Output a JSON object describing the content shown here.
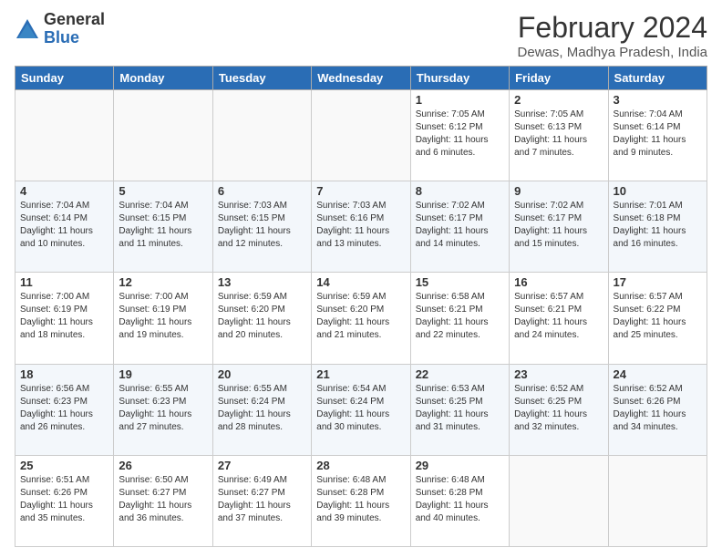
{
  "header": {
    "logo_general": "General",
    "logo_blue": "Blue",
    "month_title": "February 2024",
    "location": "Dewas, Madhya Pradesh, India"
  },
  "weekdays": [
    "Sunday",
    "Monday",
    "Tuesday",
    "Wednesday",
    "Thursday",
    "Friday",
    "Saturday"
  ],
  "weeks": [
    [
      {
        "day": "",
        "sunrise": "",
        "sunset": "",
        "daylight": ""
      },
      {
        "day": "",
        "sunrise": "",
        "sunset": "",
        "daylight": ""
      },
      {
        "day": "",
        "sunrise": "",
        "sunset": "",
        "daylight": ""
      },
      {
        "day": "",
        "sunrise": "",
        "sunset": "",
        "daylight": ""
      },
      {
        "day": "1",
        "sunrise": "Sunrise: 7:05 AM",
        "sunset": "Sunset: 6:12 PM",
        "daylight": "Daylight: 11 hours and 6 minutes."
      },
      {
        "day": "2",
        "sunrise": "Sunrise: 7:05 AM",
        "sunset": "Sunset: 6:13 PM",
        "daylight": "Daylight: 11 hours and 7 minutes."
      },
      {
        "day": "3",
        "sunrise": "Sunrise: 7:04 AM",
        "sunset": "Sunset: 6:14 PM",
        "daylight": "Daylight: 11 hours and 9 minutes."
      }
    ],
    [
      {
        "day": "4",
        "sunrise": "Sunrise: 7:04 AM",
        "sunset": "Sunset: 6:14 PM",
        "daylight": "Daylight: 11 hours and 10 minutes."
      },
      {
        "day": "5",
        "sunrise": "Sunrise: 7:04 AM",
        "sunset": "Sunset: 6:15 PM",
        "daylight": "Daylight: 11 hours and 11 minutes."
      },
      {
        "day": "6",
        "sunrise": "Sunrise: 7:03 AM",
        "sunset": "Sunset: 6:15 PM",
        "daylight": "Daylight: 11 hours and 12 minutes."
      },
      {
        "day": "7",
        "sunrise": "Sunrise: 7:03 AM",
        "sunset": "Sunset: 6:16 PM",
        "daylight": "Daylight: 11 hours and 13 minutes."
      },
      {
        "day": "8",
        "sunrise": "Sunrise: 7:02 AM",
        "sunset": "Sunset: 6:17 PM",
        "daylight": "Daylight: 11 hours and 14 minutes."
      },
      {
        "day": "9",
        "sunrise": "Sunrise: 7:02 AM",
        "sunset": "Sunset: 6:17 PM",
        "daylight": "Daylight: 11 hours and 15 minutes."
      },
      {
        "day": "10",
        "sunrise": "Sunrise: 7:01 AM",
        "sunset": "Sunset: 6:18 PM",
        "daylight": "Daylight: 11 hours and 16 minutes."
      }
    ],
    [
      {
        "day": "11",
        "sunrise": "Sunrise: 7:00 AM",
        "sunset": "Sunset: 6:19 PM",
        "daylight": "Daylight: 11 hours and 18 minutes."
      },
      {
        "day": "12",
        "sunrise": "Sunrise: 7:00 AM",
        "sunset": "Sunset: 6:19 PM",
        "daylight": "Daylight: 11 hours and 19 minutes."
      },
      {
        "day": "13",
        "sunrise": "Sunrise: 6:59 AM",
        "sunset": "Sunset: 6:20 PM",
        "daylight": "Daylight: 11 hours and 20 minutes."
      },
      {
        "day": "14",
        "sunrise": "Sunrise: 6:59 AM",
        "sunset": "Sunset: 6:20 PM",
        "daylight": "Daylight: 11 hours and 21 minutes."
      },
      {
        "day": "15",
        "sunrise": "Sunrise: 6:58 AM",
        "sunset": "Sunset: 6:21 PM",
        "daylight": "Daylight: 11 hours and 22 minutes."
      },
      {
        "day": "16",
        "sunrise": "Sunrise: 6:57 AM",
        "sunset": "Sunset: 6:21 PM",
        "daylight": "Daylight: 11 hours and 24 minutes."
      },
      {
        "day": "17",
        "sunrise": "Sunrise: 6:57 AM",
        "sunset": "Sunset: 6:22 PM",
        "daylight": "Daylight: 11 hours and 25 minutes."
      }
    ],
    [
      {
        "day": "18",
        "sunrise": "Sunrise: 6:56 AM",
        "sunset": "Sunset: 6:23 PM",
        "daylight": "Daylight: 11 hours and 26 minutes."
      },
      {
        "day": "19",
        "sunrise": "Sunrise: 6:55 AM",
        "sunset": "Sunset: 6:23 PM",
        "daylight": "Daylight: 11 hours and 27 minutes."
      },
      {
        "day": "20",
        "sunrise": "Sunrise: 6:55 AM",
        "sunset": "Sunset: 6:24 PM",
        "daylight": "Daylight: 11 hours and 28 minutes."
      },
      {
        "day": "21",
        "sunrise": "Sunrise: 6:54 AM",
        "sunset": "Sunset: 6:24 PM",
        "daylight": "Daylight: 11 hours and 30 minutes."
      },
      {
        "day": "22",
        "sunrise": "Sunrise: 6:53 AM",
        "sunset": "Sunset: 6:25 PM",
        "daylight": "Daylight: 11 hours and 31 minutes."
      },
      {
        "day": "23",
        "sunrise": "Sunrise: 6:52 AM",
        "sunset": "Sunset: 6:25 PM",
        "daylight": "Daylight: 11 hours and 32 minutes."
      },
      {
        "day": "24",
        "sunrise": "Sunrise: 6:52 AM",
        "sunset": "Sunset: 6:26 PM",
        "daylight": "Daylight: 11 hours and 34 minutes."
      }
    ],
    [
      {
        "day": "25",
        "sunrise": "Sunrise: 6:51 AM",
        "sunset": "Sunset: 6:26 PM",
        "daylight": "Daylight: 11 hours and 35 minutes."
      },
      {
        "day": "26",
        "sunrise": "Sunrise: 6:50 AM",
        "sunset": "Sunset: 6:27 PM",
        "daylight": "Daylight: 11 hours and 36 minutes."
      },
      {
        "day": "27",
        "sunrise": "Sunrise: 6:49 AM",
        "sunset": "Sunset: 6:27 PM",
        "daylight": "Daylight: 11 hours and 37 minutes."
      },
      {
        "day": "28",
        "sunrise": "Sunrise: 6:48 AM",
        "sunset": "Sunset: 6:28 PM",
        "daylight": "Daylight: 11 hours and 39 minutes."
      },
      {
        "day": "29",
        "sunrise": "Sunrise: 6:48 AM",
        "sunset": "Sunset: 6:28 PM",
        "daylight": "Daylight: 11 hours and 40 minutes."
      },
      {
        "day": "",
        "sunrise": "",
        "sunset": "",
        "daylight": ""
      },
      {
        "day": "",
        "sunrise": "",
        "sunset": "",
        "daylight": ""
      }
    ]
  ]
}
